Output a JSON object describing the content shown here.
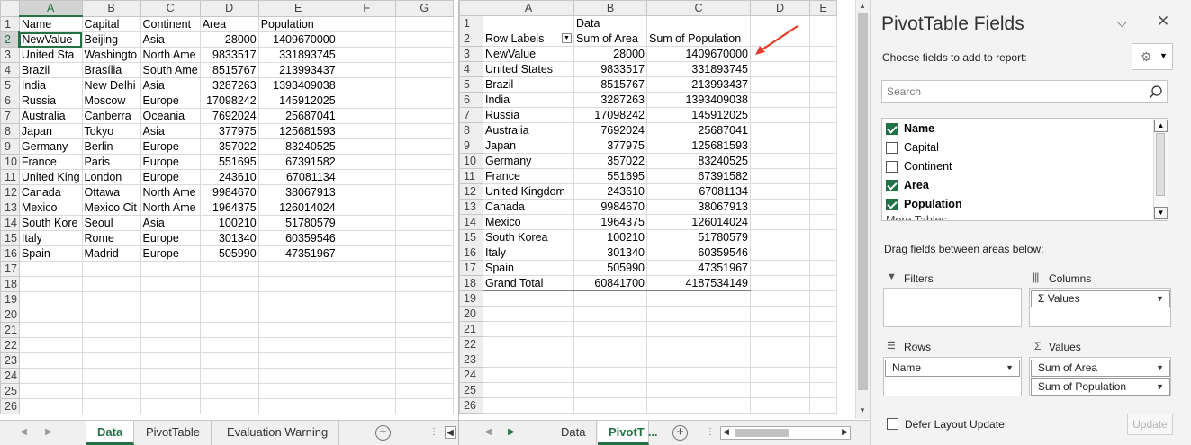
{
  "left_sheet": {
    "col_headers": [
      "A",
      "B",
      "C",
      "D",
      "E",
      "F",
      "G"
    ],
    "row_numbers": [
      "1",
      "2",
      "3",
      "4",
      "5",
      "6",
      "7",
      "8",
      "9",
      "10",
      "11",
      "12",
      "13",
      "14",
      "15",
      "16",
      "17",
      "18",
      "19",
      "20",
      "21",
      "22",
      "23",
      "24",
      "25",
      "26"
    ],
    "rows": [
      [
        "Name",
        "Capital",
        "Continent",
        "Area",
        "Population"
      ],
      [
        "NewValue",
        "Beijing",
        "Asia",
        "28000",
        "1409670000"
      ],
      [
        "United Sta",
        "Washingto",
        "North Ame",
        "9833517",
        "331893745"
      ],
      [
        "Brazil",
        "Brasília",
        "South Ame",
        "8515767",
        "213993437"
      ],
      [
        "India",
        "New Delhi",
        "Asia",
        "3287263",
        "1393409038"
      ],
      [
        "Russia",
        "Moscow",
        "Europe",
        "17098242",
        "145912025"
      ],
      [
        "Australia",
        "Canberra",
        "Oceania",
        "7692024",
        "25687041"
      ],
      [
        "Japan",
        "Tokyo",
        "Asia",
        "377975",
        "125681593"
      ],
      [
        "Germany",
        "Berlin",
        "Europe",
        "357022",
        "83240525"
      ],
      [
        "France",
        "Paris",
        "Europe",
        "551695",
        "67391582"
      ],
      [
        "United King",
        "London",
        "Europe",
        "243610",
        "67081134"
      ],
      [
        "Canada",
        "Ottawa",
        "North Ame",
        "9984670",
        "38067913"
      ],
      [
        "Mexico",
        "Mexico Cit",
        "North Ame",
        "1964375",
        "126014024"
      ],
      [
        "South Kore",
        "Seoul",
        "Asia",
        "100210",
        "51780579"
      ],
      [
        "Italy",
        "Rome",
        "Europe",
        "301340",
        "60359546"
      ],
      [
        "Spain",
        "Madrid",
        "Europe",
        "505990",
        "47351967"
      ]
    ],
    "tabs": [
      "Data",
      "PivotTable",
      "Evaluation Warning"
    ],
    "active_tab": "Data"
  },
  "pivot_sheet": {
    "col_headers": [
      "A",
      "B",
      "C",
      "D",
      "E"
    ],
    "row_numbers": [
      "1",
      "2",
      "3",
      "4",
      "5",
      "6",
      "7",
      "8",
      "9",
      "10",
      "11",
      "12",
      "13",
      "14",
      "15",
      "16",
      "17",
      "18",
      "19",
      "20",
      "21",
      "22",
      "23",
      "24",
      "25",
      "26"
    ],
    "data_header": "Data",
    "row_labels_header": "Row Labels",
    "sum_area_header": "Sum of Area",
    "sum_pop_header": "Sum of Population",
    "rows": [
      [
        "NewValue",
        "28000",
        "1409670000"
      ],
      [
        "United States",
        "9833517",
        "331893745"
      ],
      [
        "Brazil",
        "8515767",
        "213993437"
      ],
      [
        "India",
        "3287263",
        "1393409038"
      ],
      [
        "Russia",
        "17098242",
        "145912025"
      ],
      [
        "Australia",
        "7692024",
        "25687041"
      ],
      [
        "Japan",
        "377975",
        "125681593"
      ],
      [
        "Germany",
        "357022",
        "83240525"
      ],
      [
        "France",
        "551695",
        "67391582"
      ],
      [
        "United Kingdom",
        "243610",
        "67081134"
      ],
      [
        "Canada",
        "9984670",
        "38067913"
      ],
      [
        "Mexico",
        "1964375",
        "126014024"
      ],
      [
        "South Korea",
        "100210",
        "51780579"
      ],
      [
        "Italy",
        "301340",
        "60359546"
      ],
      [
        "Spain",
        "505990",
        "47351967"
      ]
    ],
    "grand_total": [
      "Grand Total",
      "60841700",
      "4187534149"
    ],
    "tabs": [
      "Data",
      "PivotT"
    ],
    "ellipsis": "...",
    "active_tab": "PivotT"
  },
  "panel": {
    "title": "PivotTable Fields",
    "choose_label": "Choose fields to add to report:",
    "search_placeholder": "Search",
    "fields": [
      {
        "label": "Name",
        "checked": true
      },
      {
        "label": "Capital",
        "checked": false
      },
      {
        "label": "Continent",
        "checked": false
      },
      {
        "label": "Area",
        "checked": true
      },
      {
        "label": "Population",
        "checked": true
      }
    ],
    "more_tables": "More Tables...",
    "drag_label": "Drag fields between areas below:",
    "filters_label": "Filters",
    "columns_label": "Columns",
    "rows_label": "Rows",
    "values_label": "Values",
    "columns_items": [
      "Values"
    ],
    "rows_items": [
      "Name"
    ],
    "values_items": [
      "Sum of Area",
      "Sum of Population"
    ],
    "defer_label": "Defer Layout Update",
    "update_label": "Update",
    "sigma": "Σ"
  },
  "colors": {
    "accent": "#217346",
    "arrow": "#e03c28"
  }
}
